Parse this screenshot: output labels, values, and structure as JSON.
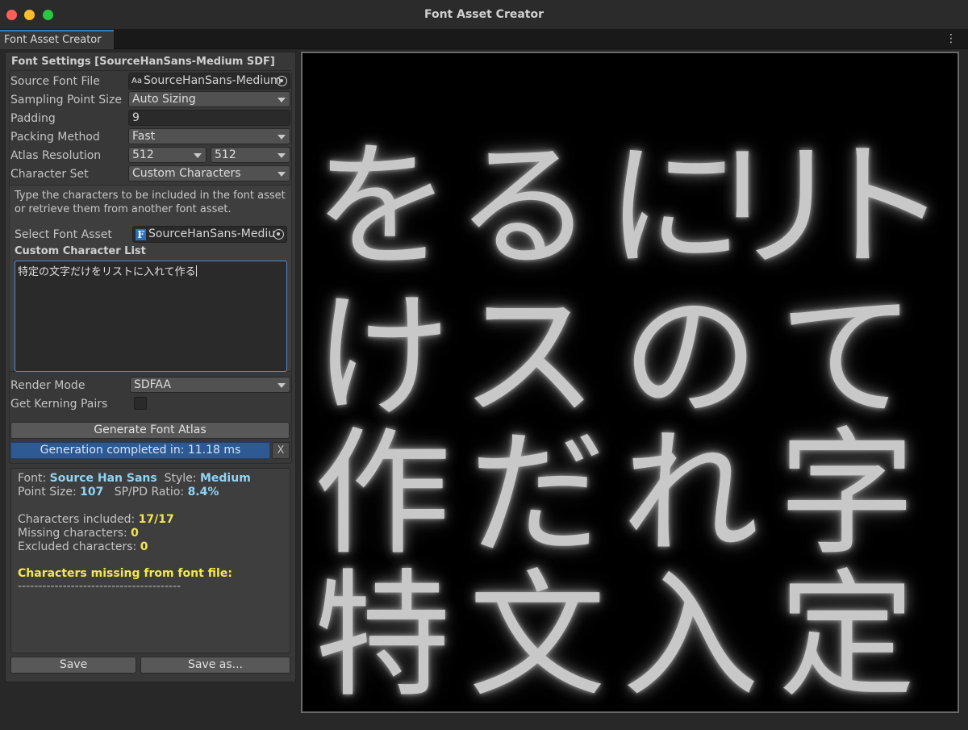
{
  "window": {
    "title": "Font Asset Creator"
  },
  "tab": {
    "label": "Font Asset Creator",
    "menu_glyph": "⋮"
  },
  "settings": {
    "section_title": "Font Settings [SourceHanSans-Medium SDF]",
    "source_font_file": {
      "label": "Source Font File",
      "value": "SourceHanSans-Medium",
      "icon": "Aa"
    },
    "sampling_point_size": {
      "label": "Sampling Point Size",
      "value": "Auto Sizing"
    },
    "padding": {
      "label": "Padding",
      "value": "9"
    },
    "packing_method": {
      "label": "Packing Method",
      "value": "Fast"
    },
    "atlas_resolution": {
      "label": "Atlas Resolution",
      "width": "512",
      "height": "512"
    },
    "character_set": {
      "label": "Character Set",
      "value": "Custom Characters"
    },
    "help_text": "Type the characters to be included in the font asset or retrieve them from another font asset.",
    "select_font_asset": {
      "label": "Select Font Asset",
      "value": "SourceHanSans-Mediu",
      "icon": "F"
    },
    "custom_character_list": {
      "label": "Custom Character List",
      "value": "特定の文字だけをリストに入れて作る"
    },
    "render_mode": {
      "label": "Render Mode",
      "value": "SDFAA"
    },
    "get_kerning_pairs": {
      "label": "Get Kerning Pairs",
      "checked": false
    }
  },
  "actions": {
    "generate_label": "Generate Font Atlas",
    "progress_text": "Generation completed in: 11.18 ms",
    "progress_fraction": 1.0,
    "progress_close": "X",
    "save_label": "Save",
    "save_as_label": "Save as..."
  },
  "info": {
    "font_label": "Font: ",
    "font_value": "Source Han Sans",
    "style_label": "Style: ",
    "style_value": "Medium",
    "point_size_label": "Point Size: ",
    "point_size_value": "107",
    "ratio_label": "SP/PD Ratio: ",
    "ratio_value": "8.4%",
    "included_label": "Characters included: ",
    "included_value": "17/17",
    "missing_label": "Missing characters: ",
    "missing_value": "0",
    "excluded_label": "Excluded characters: ",
    "excluded_value": "0",
    "missing_from_file_label": "Characters missing from font file:",
    "separator": "----------------------------------------"
  },
  "atlas_preview": {
    "rows": [
      [
        "を",
        "る",
        "に",
        "リ",
        "ト"
      ],
      [
        "け",
        "ス",
        "の",
        "て"
      ],
      [
        "作",
        "だ",
        "れ",
        "字"
      ],
      [
        "特",
        "文",
        "入",
        "定"
      ]
    ]
  },
  "colors": {
    "accent": "#3a79bb",
    "progress": "#2e5a94",
    "info_value": "#8fd4f5",
    "info_highlight": "#f3e84a"
  }
}
